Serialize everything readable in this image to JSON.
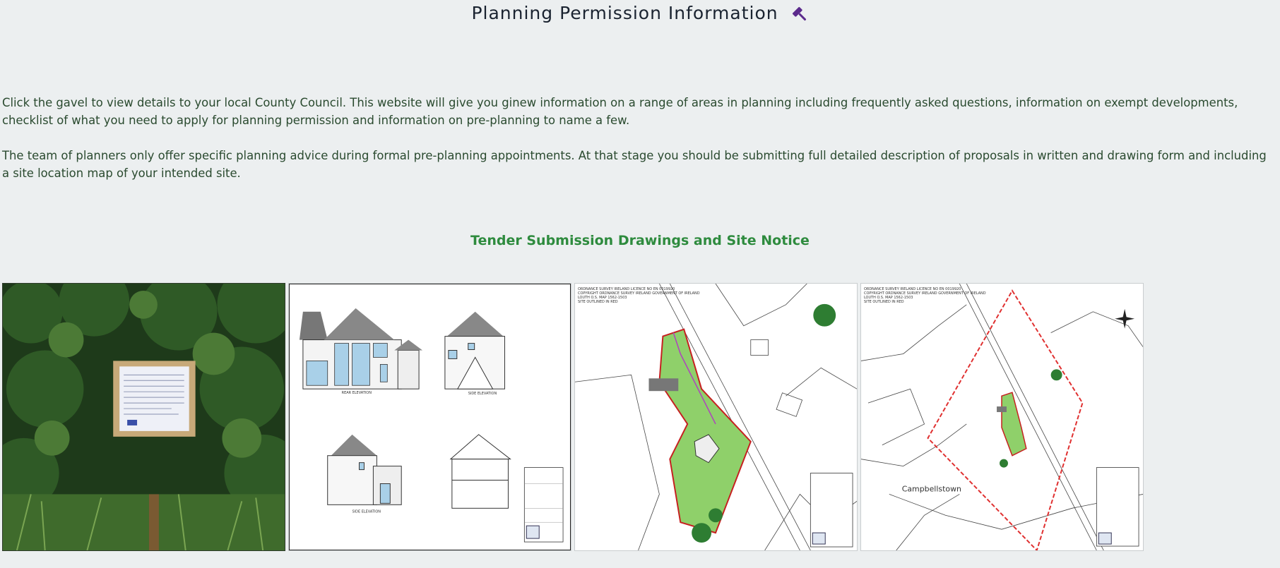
{
  "header": {
    "title": "Planning Permission Information",
    "gavel_icon": "gavel-icon",
    "gavel_color": "#5b2a8c"
  },
  "intro": {
    "paragraph_1": "Click the gavel to view details to your local County Council. This website will give you ginew information on a range of areas in planning including frequently asked questions, information on exempt developments, checklist of what you need to apply for planning permission and information on pre-planning to name a few.",
    "paragraph_2": "The team of planners only offer specific planning advice during formal pre-planning appointments. At that stage you should be submitting full detailed description of proposals in written and drawing form and including a site location map of your intended site."
  },
  "gallery": {
    "heading": "Tender Submission Drawings and Site Notice",
    "heading_color": "#2e8b3e",
    "images": [
      {
        "kind": "photo-site-notice"
      },
      {
        "kind": "drawing-elevations",
        "labels": [
          "REAR ELEVATION",
          "SIDE ELEVATION",
          "SIDE ELEVATION"
        ]
      },
      {
        "kind": "drawing-site-layout",
        "header": [
          "ORDNANCE SURVEY IRELAND LICENCE NO EN 0019920",
          "COPYRIGHT ORDNANCE SURVEY IRELAND GOVERNMENT OF IRELAND",
          "LOUTH O.S. MAP 1562-1503",
          "SITE OUTLINED IN RED"
        ]
      },
      {
        "kind": "drawing-site-location",
        "place_label": "Campbellstown",
        "header": [
          "ORDNANCE SURVEY IRELAND LICENCE NO EN 0019920",
          "COPYRIGHT ORDNANCE SURVEY IRELAND GOVERNMENT OF IRELAND",
          "LOUTH O.S. MAP 1562-1503",
          "SITE OUTLINED IN RED"
        ]
      }
    ]
  }
}
